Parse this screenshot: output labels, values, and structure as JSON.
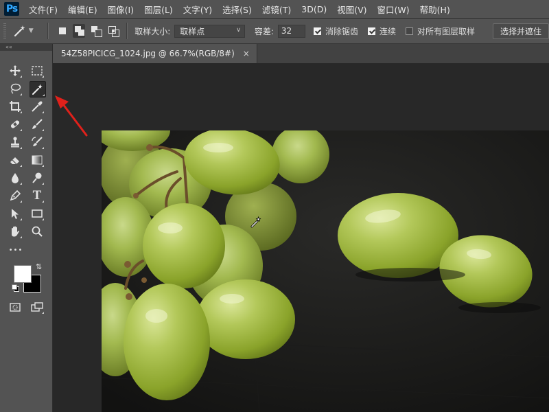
{
  "app": {
    "logo": "Ps"
  },
  "menu": [
    {
      "label": "文件(F)"
    },
    {
      "label": "编辑(E)"
    },
    {
      "label": "图像(I)"
    },
    {
      "label": "图层(L)"
    },
    {
      "label": "文字(Y)"
    },
    {
      "label": "选择(S)"
    },
    {
      "label": "滤镜(T)"
    },
    {
      "label": "3D(D)"
    },
    {
      "label": "视图(V)"
    },
    {
      "label": "窗口(W)"
    },
    {
      "label": "帮助(H)"
    }
  ],
  "options": {
    "tool_icon": "magic-wand-icon",
    "selection_modes": [
      {
        "name": "new-selection",
        "active": false
      },
      {
        "name": "add-to-selection",
        "active": true
      },
      {
        "name": "subtract-from-selection",
        "active": false
      },
      {
        "name": "intersect-with-selection",
        "active": false
      }
    ],
    "sample_size_label": "取样大小:",
    "sample_size_value": "取样点",
    "tolerance_label": "容差:",
    "tolerance_value": "32",
    "antialias_label": "消除锯齿",
    "antialias_checked": true,
    "contiguous_label": "连续",
    "contiguous_checked": true,
    "all_layers_label": "对所有图层取样",
    "all_layers_checked": false,
    "select_subject_label": "选择并遮住"
  },
  "toolbox": {
    "collapse_glyph": "««",
    "tools": [
      {
        "name": "move-tool-icon",
        "active": false
      },
      {
        "name": "marquee-tool-icon",
        "active": false
      },
      {
        "name": "lasso-tool-icon",
        "active": false
      },
      {
        "name": "magic-wand-tool-icon",
        "active": true
      },
      {
        "name": "crop-tool-icon",
        "active": false
      },
      {
        "name": "eyedropper-tool-icon",
        "active": false
      },
      {
        "name": "healing-brush-tool-icon",
        "active": false
      },
      {
        "name": "brush-tool-icon",
        "active": false
      },
      {
        "name": "clone-stamp-tool-icon",
        "active": false
      },
      {
        "name": "history-brush-tool-icon",
        "active": false
      },
      {
        "name": "eraser-tool-icon",
        "active": false
      },
      {
        "name": "gradient-tool-icon",
        "active": false
      },
      {
        "name": "blur-tool-icon",
        "active": false
      },
      {
        "name": "dodge-tool-icon",
        "active": false
      },
      {
        "name": "pen-tool-icon",
        "active": false
      },
      {
        "name": "type-tool-icon",
        "active": false
      },
      {
        "name": "path-selection-tool-icon",
        "active": false
      },
      {
        "name": "rectangle-tool-icon",
        "active": false
      },
      {
        "name": "hand-tool-icon",
        "active": false
      },
      {
        "name": "zoom-tool-icon",
        "active": false
      }
    ],
    "type_glyph": "T",
    "more_glyph": "•••",
    "foreground_color": "#ffffff",
    "background_color": "#000000"
  },
  "document": {
    "tab_title": "54Z58PICICG_1024.jpg @ 66.7%(RGB/8#)",
    "close_glyph": "×"
  },
  "colors": {
    "panel": "#535353",
    "canvas_bg": "#282828",
    "annotation_arrow": "#e0211b"
  }
}
